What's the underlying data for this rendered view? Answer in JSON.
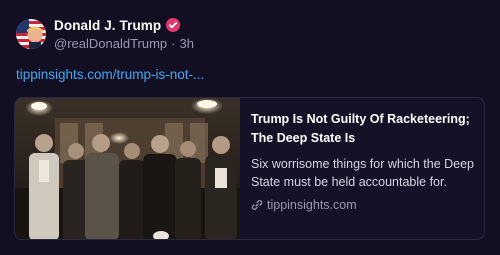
{
  "post": {
    "author": {
      "display_name": "Donald J. Trump",
      "handle": "@realDonaldTrump",
      "separator": "·",
      "time": "3h",
      "avatar_icon": "flag-avatar-icon",
      "verified_icon": "verified-badge-icon"
    },
    "link_text": "tippinsights.com/trump-is-not-...",
    "card": {
      "title": "Trump Is Not Guilty Of Racketeering; The Deep State Is",
      "description": "Six worrisome things for which the Deep State must be held accountable for.",
      "domain": "tippinsights.com",
      "domain_icon": "link-icon"
    }
  },
  "colors": {
    "background": "#130f23",
    "link": "#3ea9f5",
    "verified": "#e3366f",
    "muted": "#9a98ae",
    "card_border": "#2b2742"
  }
}
